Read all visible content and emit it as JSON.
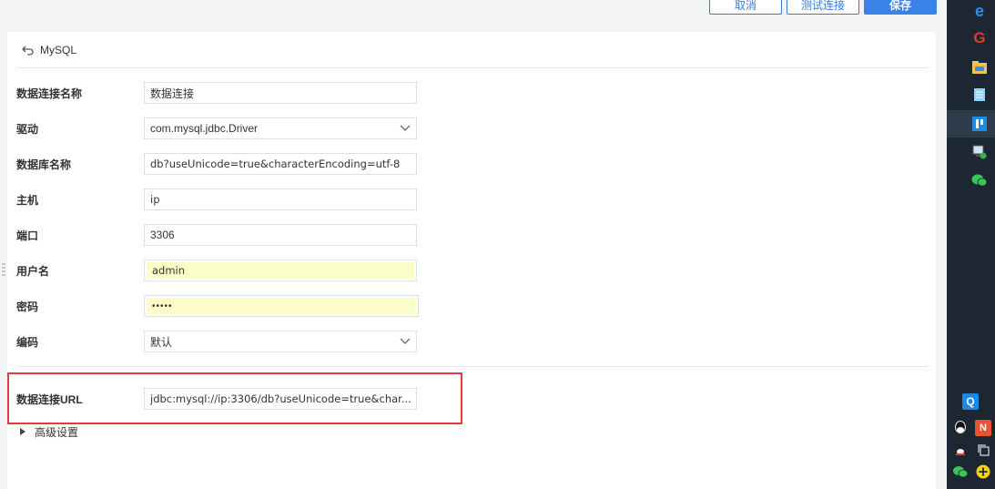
{
  "toolbar": {
    "cancel_label": "取消",
    "test_label": "测试连接",
    "save_label": "保存"
  },
  "header": {
    "title": "MySQL"
  },
  "form": {
    "name": {
      "label": "数据连接名称",
      "value": "数据连接"
    },
    "driver": {
      "label": "驱动",
      "value": "com.mysql.jdbc.Driver"
    },
    "database": {
      "label": "数据库名称",
      "value": "db?useUnicode=true&characterEncoding=utf-8"
    },
    "host": {
      "label": "主机",
      "value": "ip"
    },
    "port": {
      "label": "端口",
      "value": "3306"
    },
    "username": {
      "label": "用户名",
      "value": "admin"
    },
    "password": {
      "label": "密码",
      "value": "•••••"
    },
    "encoding": {
      "label": "编码",
      "value": "默认"
    },
    "url": {
      "label": "数据连接URL",
      "value": "jdbc:mysql://ip:3306/db?useUnicode=true&char..."
    }
  },
  "advanced": {
    "label": "高级设置"
  },
  "colors": {
    "accent": "#3b82e6",
    "highlight_box": "#e83a3a",
    "autofill": "#fafdc7",
    "taskbar": "#1c2733"
  },
  "taskbar": {
    "icons": [
      "edge-icon",
      "browser-icon",
      "file-explorer-icon",
      "notepad-icon",
      "app-icon",
      "network-icon",
      "wechat-icon",
      "search-q-icon",
      "qq-icon",
      "office-icon",
      "qq-color-icon",
      "copy-icon",
      "wechat-small-icon",
      "plus-icon"
    ]
  }
}
